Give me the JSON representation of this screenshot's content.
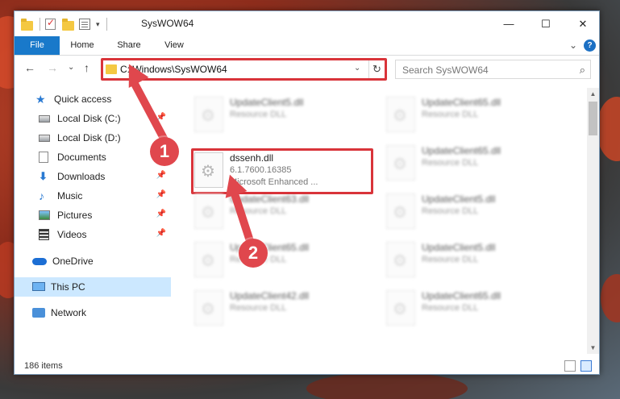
{
  "window": {
    "title": "SysWOW64",
    "controls": {
      "minimize": "—",
      "maximize": "☐",
      "close": "✕"
    }
  },
  "ribbon": {
    "tabs": [
      "File",
      "Home",
      "Share",
      "View"
    ],
    "expand_glyph": "⌄",
    "help_glyph": "?"
  },
  "navigation": {
    "back_glyph": "←",
    "forward_glyph": "→",
    "recent_glyph": "⌄",
    "up_glyph": "↑",
    "address": "C:\\Windows\\SysWOW64",
    "address_dropdown_glyph": "⌄",
    "refresh_glyph": "↻",
    "search_placeholder": "Search SysWOW64",
    "search_glyph": "⌕"
  },
  "nav_pane": {
    "items": [
      {
        "label": "Quick access",
        "icon": "star-icon",
        "pinned": false
      },
      {
        "label": "Local Disk (C:)",
        "icon": "drive-icon",
        "pinned": true
      },
      {
        "label": "Local Disk (D:)",
        "icon": "drive-icon",
        "pinned": false
      },
      {
        "label": "Documents",
        "icon": "documents-icon",
        "pinned": true
      },
      {
        "label": "Downloads",
        "icon": "downloads-icon",
        "pinned": true
      },
      {
        "label": "Music",
        "icon": "music-icon",
        "pinned": true
      },
      {
        "label": "Pictures",
        "icon": "pictures-icon",
        "pinned": true
      },
      {
        "label": "Videos",
        "icon": "videos-icon",
        "pinned": true
      },
      {
        "label": "OneDrive",
        "icon": "onedrive-icon",
        "pinned": false
      },
      {
        "label": "This PC",
        "icon": "this-pc-icon",
        "pinned": false,
        "selected": true
      },
      {
        "label": "Network",
        "icon": "network-icon",
        "pinned": false
      }
    ],
    "pin_glyph": "📌"
  },
  "files": {
    "selected": {
      "name": "dssenh.dll",
      "version": "6.1.7600.16385",
      "description": "Microsoft Enhanced ..."
    },
    "items": [
      {
        "name": "UpdateClient5.dll",
        "type": "Resource DLL"
      },
      {
        "name": "UpdateClient65.dll",
        "type": "Resource DLL"
      },
      {
        "name": "UpdateClient65.dll",
        "type": "Resource DLL"
      },
      {
        "name": "UpdateClient63.dll",
        "type": "Resource DLL"
      },
      {
        "name": "UpdateClient5.dll",
        "type": "Resource DLL"
      },
      {
        "name": "UpdateClient65.dll",
        "type": "Resource DLL"
      },
      {
        "name": "UpdateClient5.dll",
        "type": "Resource DLL"
      },
      {
        "name": "UpdateClient42.dll",
        "type": "Resource DLL"
      },
      {
        "name": "UpdateClient65.dll",
        "type": "Resource DLL"
      }
    ]
  },
  "status": {
    "item_count": "186 items"
  },
  "annotations": {
    "step1": "1",
    "step2": "2",
    "color": "#e0474d"
  }
}
